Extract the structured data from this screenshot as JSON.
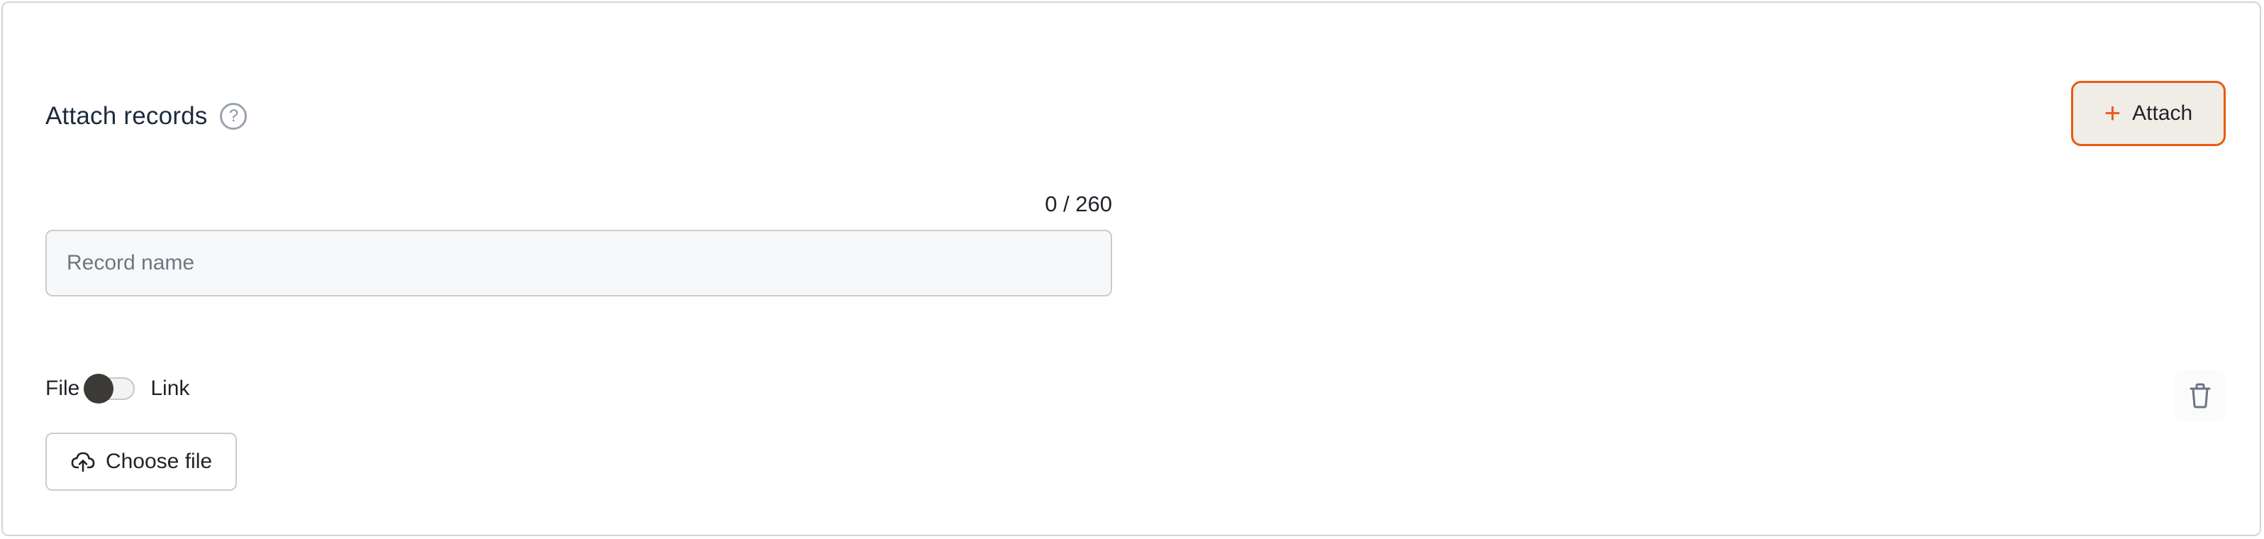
{
  "section": {
    "title": "Attach records",
    "help_icon": "question-circle-icon",
    "help_glyph": "?"
  },
  "attach_button": {
    "icon": "plus-icon",
    "plus_glyph": "+",
    "label": "Attach"
  },
  "record_name": {
    "counter": "0 / 260",
    "value": "",
    "placeholder": "Record name"
  },
  "source_toggle": {
    "left_label": "File",
    "right_label": "Link",
    "state": "File"
  },
  "delete_button": {
    "icon": "trash-icon"
  },
  "choose_file_button": {
    "icon": "cloud-upload-icon",
    "label": "Choose file"
  },
  "colors": {
    "accent": "#ea5a12",
    "accent_bg": "#f0ede7",
    "title": "#1d2b3d",
    "border": "#c9cdd2"
  }
}
